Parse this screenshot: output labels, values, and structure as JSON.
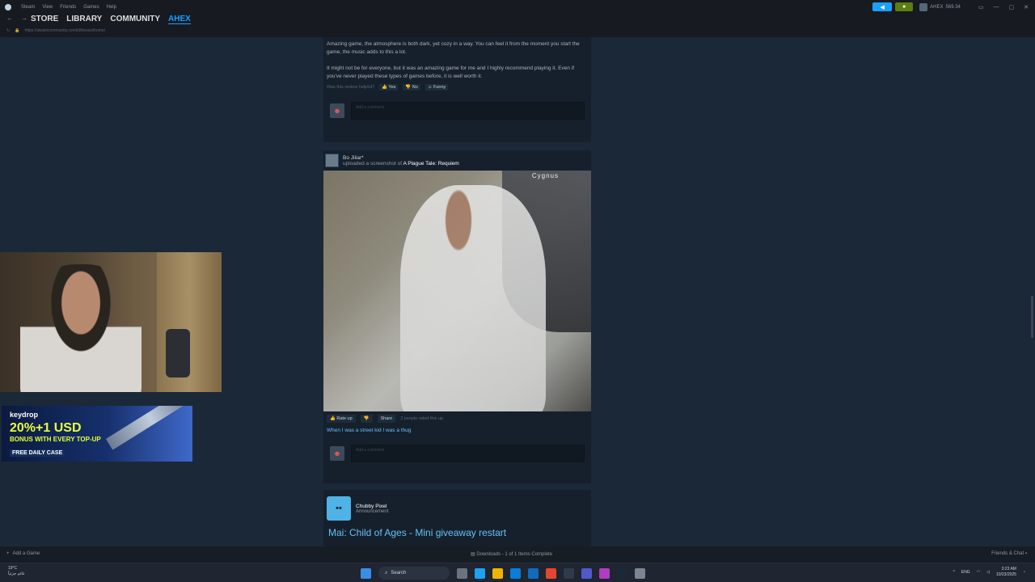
{
  "titlebar": {
    "menu": [
      "Steam",
      "View",
      "Friends",
      "Games",
      "Help"
    ],
    "account_name": "AHEX",
    "balance": "569.34"
  },
  "nav": {
    "links": [
      "STORE",
      "LIBRARY",
      "COMMUNITY",
      "AHEX"
    ],
    "active": "AHEX",
    "url": "https://steamcommunity.com/id/hexaxi/home/"
  },
  "review": {
    "paragraph1": "Amazing game, the atmosphere is both dark, yet cozy in a way. You can feel it from the moment you start the game, the music adds to this a lot.",
    "paragraph2": "It might not be for everyone, but it was an amazing game for me and I highly recommend playing it. Even if you've never played these types of games before, it is well worth it.",
    "helpful_label": "Was this review helpful?",
    "yes": "Yes",
    "no": "No",
    "funny": "Funny",
    "comment_placeholder": "Add a comment"
  },
  "screenshot_post": {
    "user": "Bo Jiliar*",
    "action": "uploaded a screenshot of",
    "game": "A Plague Tale: Requiem",
    "watermark": "Cygnus",
    "rate_up": "Rate up",
    "share": "Share",
    "rated_text": "2 people rated this up",
    "caption": "When I was a street kid I was a thug",
    "comment_placeholder": "Add a comment"
  },
  "announcement": {
    "developer": "Chubby Pixel",
    "type": "Announcement",
    "title": "Mai: Child of Ages - Mini giveaway restart"
  },
  "ad": {
    "brand": "keydrop",
    "headline": "20%+1 USD",
    "subline": "BONUS WITH EVERY TOP-UP",
    "cta": "FREE DAILY CASE"
  },
  "bottombar": {
    "add_game": "Add a Game",
    "downloads": "Downloads - 1 of 1 Items Complete",
    "friends_chat": "Friends & Chat"
  },
  "taskbar": {
    "weather_temp": "19°C",
    "weather_desc": "غائم جزئياً",
    "search": "Search",
    "lang": "ENG",
    "time": "3:23 AM",
    "date": "10/23/2025"
  }
}
